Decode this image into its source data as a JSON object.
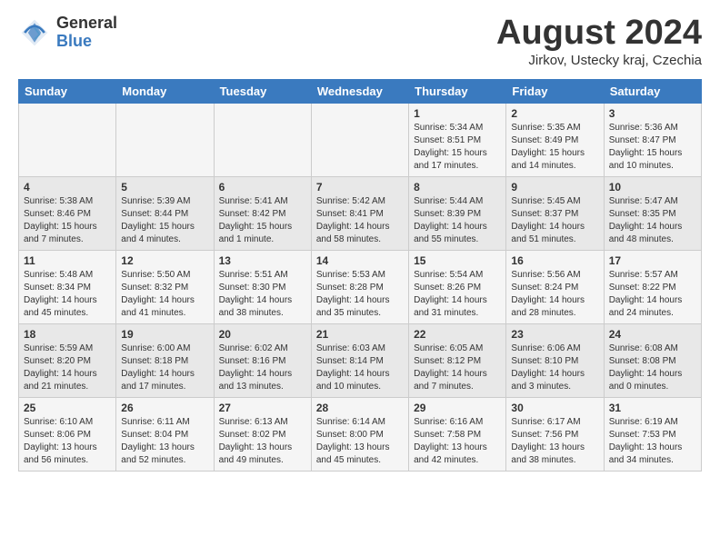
{
  "header": {
    "logo_general": "General",
    "logo_blue": "Blue",
    "month_year": "August 2024",
    "location": "Jirkov, Ustecky kraj, Czechia"
  },
  "weekdays": [
    "Sunday",
    "Monday",
    "Tuesday",
    "Wednesday",
    "Thursday",
    "Friday",
    "Saturday"
  ],
  "weeks": [
    [
      {
        "day": "",
        "info": ""
      },
      {
        "day": "",
        "info": ""
      },
      {
        "day": "",
        "info": ""
      },
      {
        "day": "",
        "info": ""
      },
      {
        "day": "1",
        "info": "Sunrise: 5:34 AM\nSunset: 8:51 PM\nDaylight: 15 hours\nand 17 minutes."
      },
      {
        "day": "2",
        "info": "Sunrise: 5:35 AM\nSunset: 8:49 PM\nDaylight: 15 hours\nand 14 minutes."
      },
      {
        "day": "3",
        "info": "Sunrise: 5:36 AM\nSunset: 8:47 PM\nDaylight: 15 hours\nand 10 minutes."
      }
    ],
    [
      {
        "day": "4",
        "info": "Sunrise: 5:38 AM\nSunset: 8:46 PM\nDaylight: 15 hours\nand 7 minutes."
      },
      {
        "day": "5",
        "info": "Sunrise: 5:39 AM\nSunset: 8:44 PM\nDaylight: 15 hours\nand 4 minutes."
      },
      {
        "day": "6",
        "info": "Sunrise: 5:41 AM\nSunset: 8:42 PM\nDaylight: 15 hours\nand 1 minute."
      },
      {
        "day": "7",
        "info": "Sunrise: 5:42 AM\nSunset: 8:41 PM\nDaylight: 14 hours\nand 58 minutes."
      },
      {
        "day": "8",
        "info": "Sunrise: 5:44 AM\nSunset: 8:39 PM\nDaylight: 14 hours\nand 55 minutes."
      },
      {
        "day": "9",
        "info": "Sunrise: 5:45 AM\nSunset: 8:37 PM\nDaylight: 14 hours\nand 51 minutes."
      },
      {
        "day": "10",
        "info": "Sunrise: 5:47 AM\nSunset: 8:35 PM\nDaylight: 14 hours\nand 48 minutes."
      }
    ],
    [
      {
        "day": "11",
        "info": "Sunrise: 5:48 AM\nSunset: 8:34 PM\nDaylight: 14 hours\nand 45 minutes."
      },
      {
        "day": "12",
        "info": "Sunrise: 5:50 AM\nSunset: 8:32 PM\nDaylight: 14 hours\nand 41 minutes."
      },
      {
        "day": "13",
        "info": "Sunrise: 5:51 AM\nSunset: 8:30 PM\nDaylight: 14 hours\nand 38 minutes."
      },
      {
        "day": "14",
        "info": "Sunrise: 5:53 AM\nSunset: 8:28 PM\nDaylight: 14 hours\nand 35 minutes."
      },
      {
        "day": "15",
        "info": "Sunrise: 5:54 AM\nSunset: 8:26 PM\nDaylight: 14 hours\nand 31 minutes."
      },
      {
        "day": "16",
        "info": "Sunrise: 5:56 AM\nSunset: 8:24 PM\nDaylight: 14 hours\nand 28 minutes."
      },
      {
        "day": "17",
        "info": "Sunrise: 5:57 AM\nSunset: 8:22 PM\nDaylight: 14 hours\nand 24 minutes."
      }
    ],
    [
      {
        "day": "18",
        "info": "Sunrise: 5:59 AM\nSunset: 8:20 PM\nDaylight: 14 hours\nand 21 minutes."
      },
      {
        "day": "19",
        "info": "Sunrise: 6:00 AM\nSunset: 8:18 PM\nDaylight: 14 hours\nand 17 minutes."
      },
      {
        "day": "20",
        "info": "Sunrise: 6:02 AM\nSunset: 8:16 PM\nDaylight: 14 hours\nand 13 minutes."
      },
      {
        "day": "21",
        "info": "Sunrise: 6:03 AM\nSunset: 8:14 PM\nDaylight: 14 hours\nand 10 minutes."
      },
      {
        "day": "22",
        "info": "Sunrise: 6:05 AM\nSunset: 8:12 PM\nDaylight: 14 hours\nand 7 minutes."
      },
      {
        "day": "23",
        "info": "Sunrise: 6:06 AM\nSunset: 8:10 PM\nDaylight: 14 hours\nand 3 minutes."
      },
      {
        "day": "24",
        "info": "Sunrise: 6:08 AM\nSunset: 8:08 PM\nDaylight: 14 hours\nand 0 minutes."
      }
    ],
    [
      {
        "day": "25",
        "info": "Sunrise: 6:10 AM\nSunset: 8:06 PM\nDaylight: 13 hours\nand 56 minutes."
      },
      {
        "day": "26",
        "info": "Sunrise: 6:11 AM\nSunset: 8:04 PM\nDaylight: 13 hours\nand 52 minutes."
      },
      {
        "day": "27",
        "info": "Sunrise: 6:13 AM\nSunset: 8:02 PM\nDaylight: 13 hours\nand 49 minutes."
      },
      {
        "day": "28",
        "info": "Sunrise: 6:14 AM\nSunset: 8:00 PM\nDaylight: 13 hours\nand 45 minutes."
      },
      {
        "day": "29",
        "info": "Sunrise: 6:16 AM\nSunset: 7:58 PM\nDaylight: 13 hours\nand 42 minutes."
      },
      {
        "day": "30",
        "info": "Sunrise: 6:17 AM\nSunset: 7:56 PM\nDaylight: 13 hours\nand 38 minutes."
      },
      {
        "day": "31",
        "info": "Sunrise: 6:19 AM\nSunset: 7:53 PM\nDaylight: 13 hours\nand 34 minutes."
      }
    ]
  ]
}
